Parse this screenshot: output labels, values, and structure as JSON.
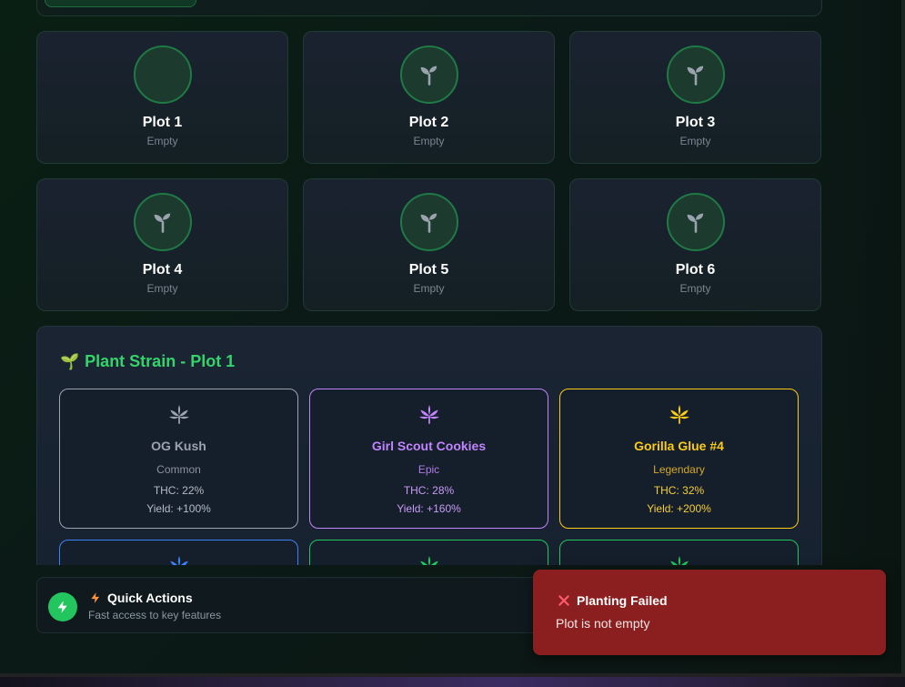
{
  "plots": [
    {
      "name": "Plot 1",
      "status": "Empty",
      "icon": "none"
    },
    {
      "name": "Plot 2",
      "status": "Empty",
      "icon": "sprout-icon"
    },
    {
      "name": "Plot 3",
      "status": "Empty",
      "icon": "sprout-icon"
    },
    {
      "name": "Plot 4",
      "status": "Empty",
      "icon": "sprout-icon"
    },
    {
      "name": "Plot 5",
      "status": "Empty",
      "icon": "sprout-icon"
    },
    {
      "name": "Plot 6",
      "status": "Empty",
      "icon": "sprout-icon"
    }
  ],
  "strain_panel": {
    "title": "Plant Strain - Plot 1",
    "title_icon": "🌱",
    "strains": [
      {
        "name": "OG Kush",
        "rarity": "Common",
        "thc": "THC: 22%",
        "yield": "Yield: +100%",
        "color": "#9ca3af"
      },
      {
        "name": "Girl Scout Cookies",
        "rarity": "Epic",
        "thc": "THC: 28%",
        "yield": "Yield: +160%",
        "color": "#c084fc"
      },
      {
        "name": "Gorilla Glue #4",
        "rarity": "Legendary",
        "thc": "THC: 32%",
        "yield": "Yield: +200%",
        "color": "#facc15"
      }
    ],
    "partial_strain_colors": [
      "#3b82f6",
      "#22c55e",
      "#22c55e"
    ]
  },
  "quick_actions": {
    "title": "Quick Actions",
    "subtitle": "Fast access to key features",
    "icon": "lightning-icon"
  },
  "toast": {
    "title": "Planting Failed",
    "message": "Plot is not empty",
    "icon": "close-icon",
    "color": "#8b1e1e"
  }
}
